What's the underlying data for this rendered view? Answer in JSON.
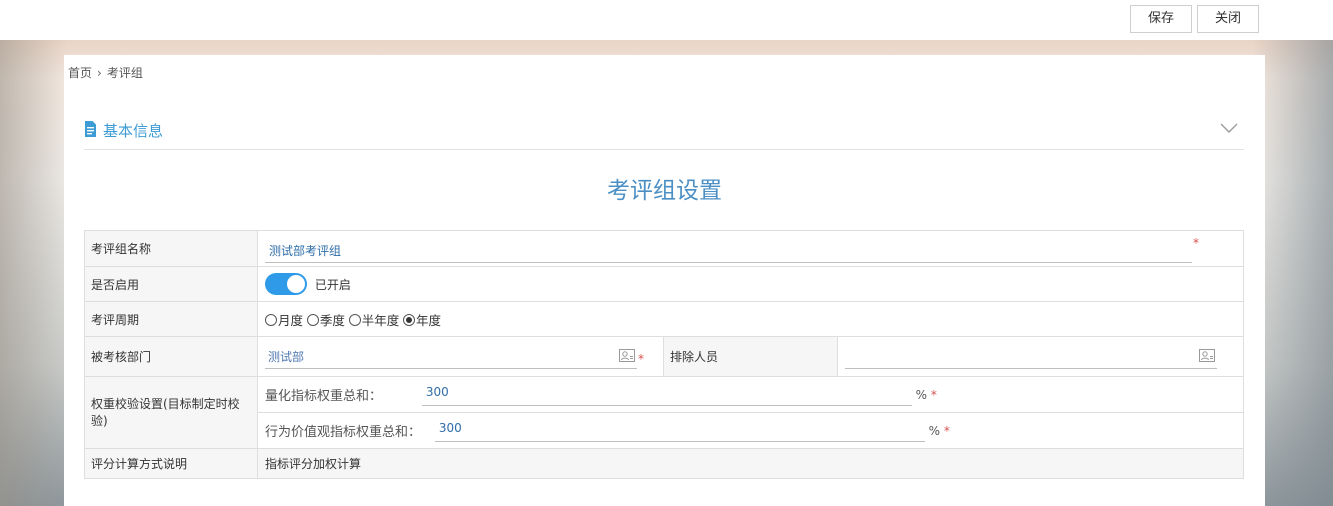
{
  "toolbar": {
    "save_label": "保存",
    "close_label": "关闭"
  },
  "breadcrumb": {
    "home": "首页",
    "separator": "›",
    "current": "考评组"
  },
  "section": {
    "title": "基本信息"
  },
  "form": {
    "title": "考评组设置",
    "required_mark": "*",
    "group_name": {
      "label": "考评组名称",
      "value": "测试部考评组"
    },
    "enabled": {
      "label": "是否启用",
      "state_text": "已开启",
      "on": true
    },
    "cycle": {
      "label": "考评周期",
      "options": [
        "月度",
        "季度",
        "半年度",
        "年度"
      ],
      "selected": "年度"
    },
    "department": {
      "label": "被考核部门",
      "value": "测试部"
    },
    "excluded": {
      "label": "排除人员",
      "value": ""
    },
    "weight_check": {
      "label": "权重校验设置(目标制定时校验)",
      "quant_label": "量化指标权重总和：",
      "quant_value": "300",
      "behavior_label": "行为价值观指标权重总和：",
      "behavior_value": "300",
      "unit": "%"
    },
    "calc": {
      "label": "评分计算方式说明",
      "value": "指标评分加权计算"
    }
  },
  "icons": {
    "section": "document-icon",
    "collapse": "chevron-down-icon",
    "picker": "contact-card-icon"
  },
  "colors": {
    "accent": "#3d9bd6",
    "title": "#4b8fc4",
    "toggle_on": "#2f9be8",
    "required": "#d9534f",
    "value_text": "#2f6ea8"
  }
}
